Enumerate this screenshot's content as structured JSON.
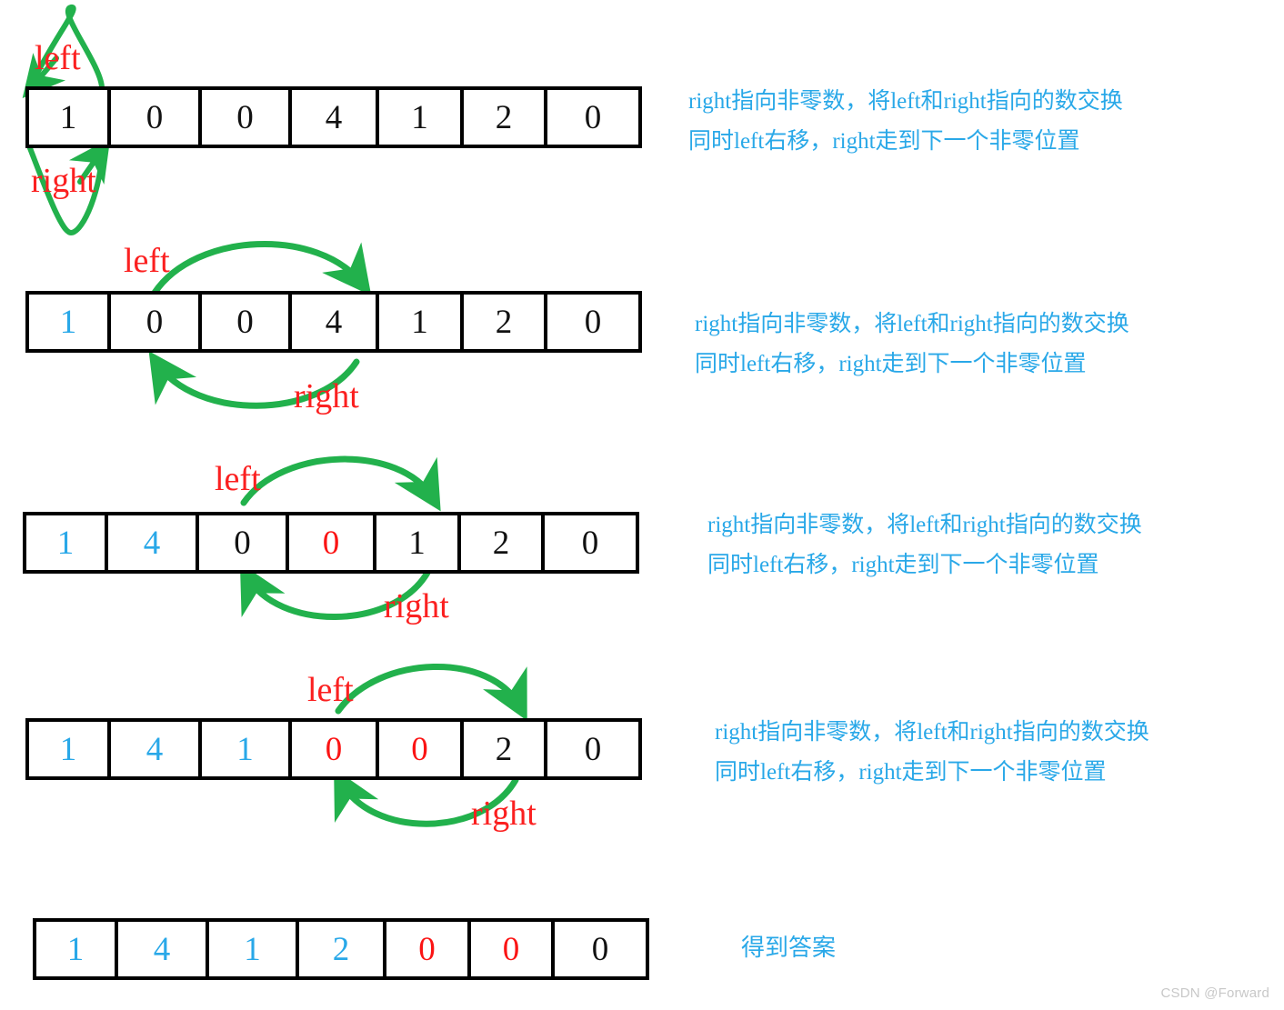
{
  "diagram": {
    "title": "Move Zeroes two-pointer walkthrough",
    "colors": {
      "value_sorted": "#29a8e8",
      "value_zero": "#fb1414",
      "value_default": "#111111",
      "pointer_label": "#fb2020",
      "arrow": "#22b14c",
      "note_text": "#29a8e8",
      "cell_border": "#000000"
    },
    "step_note_lines": [
      "right指向非零数，将left和right指向的数交换",
      "同时left右移，right走到下一个非零位置"
    ],
    "final_note": "得到答案",
    "pointer_names": {
      "left": "left",
      "right": "right"
    },
    "steps": [
      {
        "id": "step-1",
        "cells": [
          {
            "value": "1",
            "color": "black"
          },
          {
            "value": "0",
            "color": "black"
          },
          {
            "value": "0",
            "color": "black"
          },
          {
            "value": "4",
            "color": "black"
          },
          {
            "value": "1",
            "color": "black"
          },
          {
            "value": "2",
            "color": "black"
          },
          {
            "value": "0",
            "color": "black"
          }
        ],
        "left_index": 0,
        "right_index": 0,
        "left_label": "left",
        "right_label": "right",
        "note_lines": [
          "right指向非零数，将left和right指向的数交换",
          "同时left右移，right走到下一个非零位置"
        ]
      },
      {
        "id": "step-2",
        "cells": [
          {
            "value": "1",
            "color": "blue"
          },
          {
            "value": "0",
            "color": "black"
          },
          {
            "value": "0",
            "color": "black"
          },
          {
            "value": "4",
            "color": "black"
          },
          {
            "value": "1",
            "color": "black"
          },
          {
            "value": "2",
            "color": "black"
          },
          {
            "value": "0",
            "color": "black"
          }
        ],
        "left_index": 1,
        "right_index": 3,
        "left_label": "left",
        "right_label": "right",
        "note_lines": [
          "right指向非零数，将left和right指向的数交换",
          "同时left右移，right走到下一个非零位置"
        ]
      },
      {
        "id": "step-3",
        "cells": [
          {
            "value": "1",
            "color": "blue"
          },
          {
            "value": "4",
            "color": "blue"
          },
          {
            "value": "0",
            "color": "black"
          },
          {
            "value": "0",
            "color": "red"
          },
          {
            "value": "1",
            "color": "black"
          },
          {
            "value": "2",
            "color": "black"
          },
          {
            "value": "0",
            "color": "black"
          }
        ],
        "left_index": 2,
        "right_index": 4,
        "left_label": "left",
        "right_label": "right",
        "note_lines": [
          "right指向非零数，将left和right指向的数交换",
          "同时left右移，right走到下一个非零位置"
        ]
      },
      {
        "id": "step-4",
        "cells": [
          {
            "value": "1",
            "color": "blue"
          },
          {
            "value": "4",
            "color": "blue"
          },
          {
            "value": "1",
            "color": "blue"
          },
          {
            "value": "0",
            "color": "red"
          },
          {
            "value": "0",
            "color": "red"
          },
          {
            "value": "2",
            "color": "black"
          },
          {
            "value": "0",
            "color": "black"
          }
        ],
        "left_index": 3,
        "right_index": 5,
        "left_label": "left",
        "right_label": "right",
        "note_lines": [
          "right指向非零数，将left和right指向的数交换",
          "同时left右移，right走到下一个非零位置"
        ]
      },
      {
        "id": "step-5",
        "cells": [
          {
            "value": "1",
            "color": "blue"
          },
          {
            "value": "4",
            "color": "blue"
          },
          {
            "value": "1",
            "color": "blue"
          },
          {
            "value": "2",
            "color": "blue"
          },
          {
            "value": "0",
            "color": "red"
          },
          {
            "value": "0",
            "color": "red"
          },
          {
            "value": "0",
            "color": "black"
          }
        ],
        "left_index": null,
        "right_index": null,
        "left_label": "",
        "right_label": "",
        "note_lines": [
          "得到答案"
        ]
      }
    ]
  },
  "watermark": "CSDN @Forward"
}
